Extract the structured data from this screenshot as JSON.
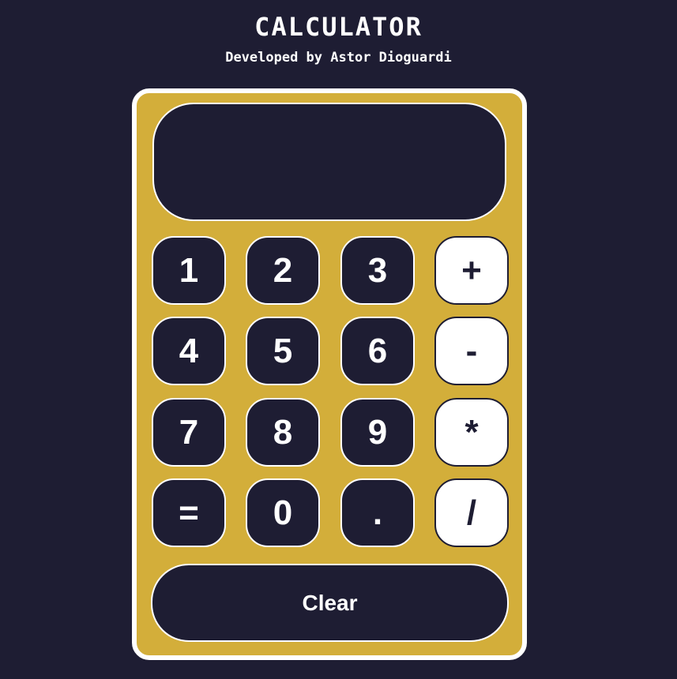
{
  "header": {
    "title": "CALCULATOR",
    "subtitle": "Developed by Astor Dioguardi"
  },
  "display": {
    "value": ""
  },
  "keys": {
    "one": "1",
    "two": "2",
    "three": "3",
    "plus": "+",
    "four": "4",
    "five": "5",
    "six": "6",
    "minus": "-",
    "seven": "7",
    "eight": "8",
    "nine": "9",
    "multiply": "*",
    "equals": "=",
    "zero": "0",
    "decimal": ".",
    "divide": "/"
  },
  "clear_label": "Clear",
  "colors": {
    "background": "#1e1d33",
    "calculator_body": "#d3ae3a",
    "key_dark": "#1e1d33",
    "key_light": "#ffffff",
    "text_light": "#ffffff"
  }
}
